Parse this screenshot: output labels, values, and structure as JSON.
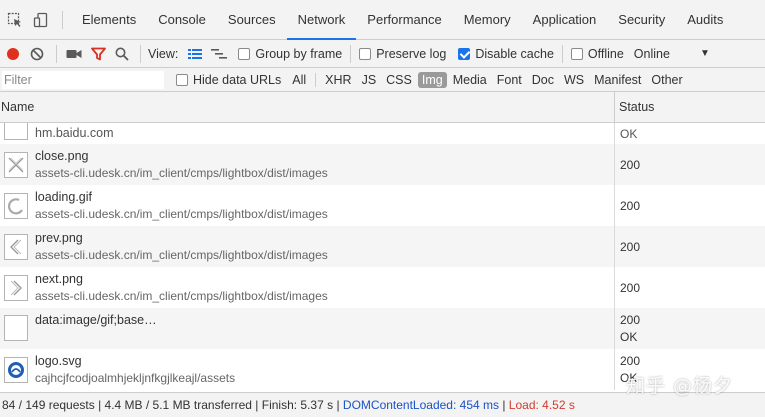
{
  "tabs": [
    {
      "label": "Elements",
      "active": false
    },
    {
      "label": "Console",
      "active": false
    },
    {
      "label": "Sources",
      "active": false
    },
    {
      "label": "Network",
      "active": true
    },
    {
      "label": "Performance",
      "active": false
    },
    {
      "label": "Memory",
      "active": false
    },
    {
      "label": "Application",
      "active": false
    },
    {
      "label": "Security",
      "active": false
    },
    {
      "label": "Audits",
      "active": false
    }
  ],
  "toolbar": {
    "view_label": "View:",
    "group_by_frame": {
      "label": "Group by frame",
      "checked": false
    },
    "preserve_log": {
      "label": "Preserve log",
      "checked": false
    },
    "disable_cache": {
      "label": "Disable cache",
      "checked": true
    },
    "offline": {
      "label": "Offline",
      "checked": false
    },
    "throttle_value": "Online"
  },
  "filterbar": {
    "placeholder": "Filter",
    "hide_data_urls": {
      "label": "Hide data URLs",
      "checked": false
    },
    "types": [
      "All",
      "XHR",
      "JS",
      "CSS",
      "Img",
      "Media",
      "Font",
      "Doc",
      "WS",
      "Manifest",
      "Other"
    ],
    "active_type": "Img"
  },
  "columns": {
    "name": "Name",
    "status": "Status"
  },
  "rows": [
    {
      "name": "hm.baidu.com",
      "path": "",
      "status": "OK",
      "status2": "",
      "icon": "blank-image-icon"
    },
    {
      "name": "close.png",
      "path": "assets-cli.udesk.cn/im_client/cmps/lightbox/dist/images",
      "status": "200",
      "status2": "",
      "icon": "close-image-icon"
    },
    {
      "name": "loading.gif",
      "path": "assets-cli.udesk.cn/im_client/cmps/lightbox/dist/images",
      "status": "200",
      "status2": "",
      "icon": "loading-image-icon"
    },
    {
      "name": "prev.png",
      "path": "assets-cli.udesk.cn/im_client/cmps/lightbox/dist/images",
      "status": "200",
      "status2": "",
      "icon": "prev-image-icon"
    },
    {
      "name": "next.png",
      "path": "assets-cli.udesk.cn/im_client/cmps/lightbox/dist/images",
      "status": "200",
      "status2": "",
      "icon": "next-image-icon"
    },
    {
      "name": "data:image/gif;base…",
      "path": "",
      "status": "200",
      "status2": "OK",
      "icon": "blank-image-icon"
    },
    {
      "name": "logo.svg",
      "path": "cajhcjfcodjoalmhjekljnfkgjlkeajl/assets",
      "status": "200",
      "status2": "OK",
      "icon": "logo-image-icon"
    }
  ],
  "statusbar": {
    "requests": "84 / 149 requests",
    "transferred": "4.4 MB / 5.1 MB transferred",
    "finish": "Finish: 5.37 s",
    "dcl": "DOMContentLoaded: 454 ms",
    "load": "Load: 4.52 s"
  },
  "watermark": "知乎 @杨夕",
  "colors": {
    "accent": "#1a73e8",
    "record": "#e0301e",
    "filter_icon": "#d93025",
    "dcl": "#1a52c4",
    "load": "#d23b2f"
  }
}
